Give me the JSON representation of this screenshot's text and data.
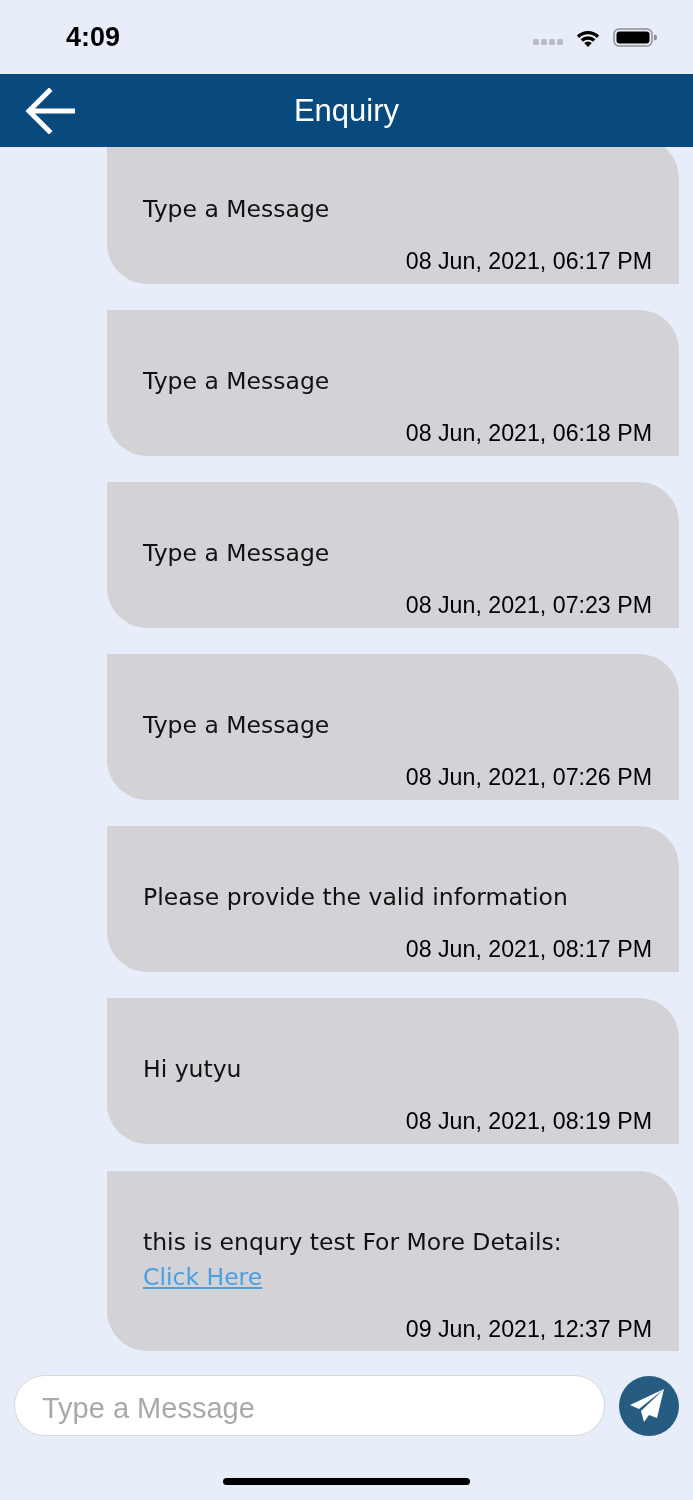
{
  "status_bar": {
    "time": "4:09"
  },
  "header": {
    "title": "Enquiry"
  },
  "messages": [
    {
      "text": "Type a Message",
      "timestamp": "08 Jun, 2021, 06:17 PM"
    },
    {
      "text": "Type a Message",
      "timestamp": "08 Jun, 2021, 06:18 PM"
    },
    {
      "text": "Type a Message",
      "timestamp": "08 Jun, 2021, 07:23 PM"
    },
    {
      "text": "Type a Message",
      "timestamp": "08 Jun, 2021, 07:26 PM"
    },
    {
      "text": "Please provide the valid information",
      "timestamp": "08 Jun, 2021, 08:17 PM"
    },
    {
      "text": "Hi yutyu",
      "timestamp": "08 Jun, 2021, 08:19 PM"
    },
    {
      "text": "this is enqury test For More Details:",
      "link": "Click Here",
      "timestamp": "09 Jun, 2021, 12:37 PM"
    }
  ],
  "composer": {
    "placeholder": "Type a Message"
  }
}
